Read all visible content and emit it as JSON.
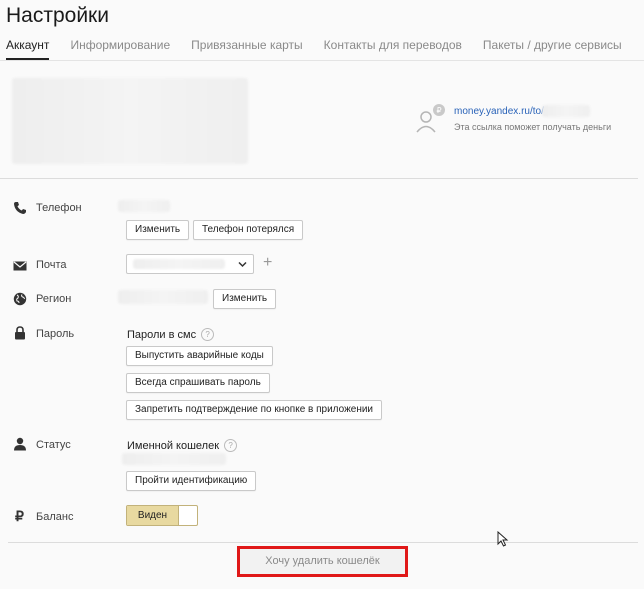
{
  "page": {
    "title": "Настройки"
  },
  "tabs": [
    {
      "label": "Аккаунт"
    },
    {
      "label": "Информирование"
    },
    {
      "label": "Привязанные карты"
    },
    {
      "label": "Контакты для переводов"
    },
    {
      "label": "Пакеты / другие сервисы"
    }
  ],
  "wallet_link": {
    "url": "money.yandex.ru/to/",
    "hint": "Эта ссылка поможет получать деньги"
  },
  "phone": {
    "label": "Телефон",
    "change": "Изменить",
    "lost": "Телефон потерялся"
  },
  "email": {
    "label": "Почта",
    "add": "+"
  },
  "region": {
    "label": "Регион",
    "change": "Изменить"
  },
  "password": {
    "label": "Пароль",
    "sms": "Пароли в смс",
    "help": "?",
    "emergency_codes": "Выпустить аварийные коды",
    "always_ask": "Всегда спрашивать пароль",
    "forbid_app_confirm": "Запретить подтверждение по кнопке в приложении"
  },
  "status": {
    "label": "Статус",
    "value": "Именной кошелек",
    "help": "?",
    "identify": "Пройти идентификацию"
  },
  "balance": {
    "label": "Баланс",
    "toggle_on": "Виден",
    "currency_symbol": "₽"
  },
  "delete_wallet": {
    "label": "Хочу удалить кошелёк",
    "highlight_color": "#e01818"
  },
  "colors": {
    "link": "#2a63b8",
    "toggle_active": "#e8d9a0"
  }
}
